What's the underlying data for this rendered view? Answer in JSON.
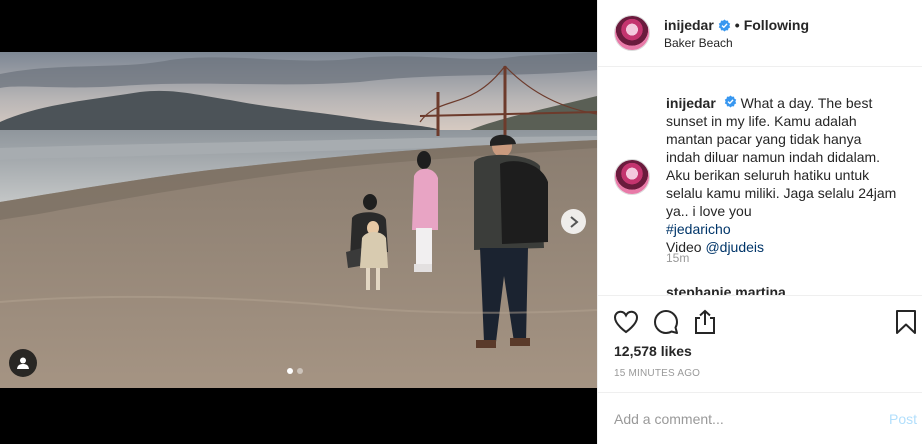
{
  "post": {
    "username": "inijedar",
    "follow_status": "Following",
    "separator": "•",
    "location": "Baker Beach",
    "caption_text": "What a day. The best sunset in my life. Kamu adalah mantan pacar yang tidak hanya indah diluar namun indah didalam. Aku berikan seluruh hatiku untuk selalu kamu miliki. Jaga selalu 24jam ya.. i love you",
    "hashtag": "#jedaricho",
    "video_label": "Video",
    "video_mention": "@djudeis",
    "caption_time": "15m",
    "next_commenter": "stephanie.martina",
    "likes": "12,578 likes",
    "posted_ago": "15 MINUTES AGO"
  },
  "comment_box": {
    "placeholder": "Add a comment...",
    "post_label": "Post"
  },
  "carousel": {
    "slide_count": 2,
    "active_slide": 1
  },
  "icons": {
    "verified": "verified-badge-icon",
    "like": "heart-icon",
    "comment": "speech-bubble-icon",
    "share": "share-icon",
    "save": "bookmark-icon",
    "next": "chevron-right-icon",
    "tags": "user-tag-icon"
  },
  "colors": {
    "verified_blue": "#3897f0",
    "link_blue": "#003569",
    "post_button_disabled": "#b2dffc",
    "muted_text": "#999999"
  }
}
